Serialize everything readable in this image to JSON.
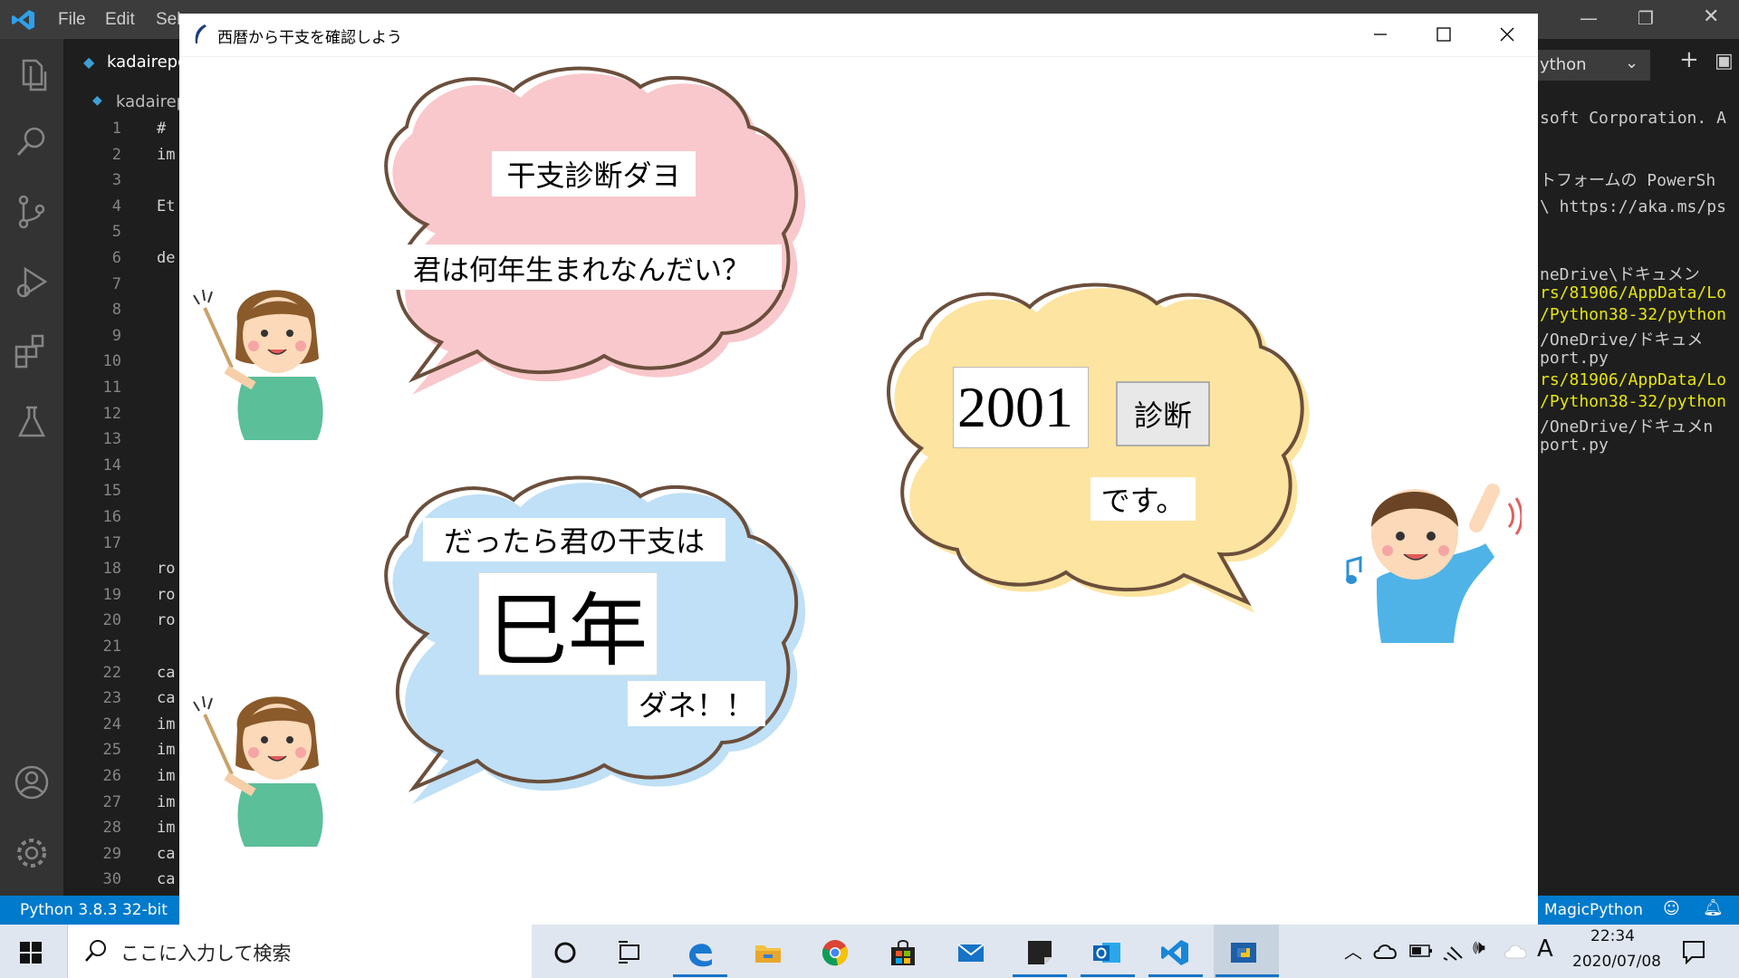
{
  "vscode": {
    "menu": [
      "File",
      "Edit",
      "Sel"
    ],
    "tab_label": "kadairepo",
    "breadcrumb_label": "kadairep",
    "line_numbers": [
      "1",
      "2",
      "3",
      "4",
      "5",
      "6",
      "7",
      "8",
      "9",
      "10",
      "11",
      "12",
      "13",
      "14",
      "15",
      "16",
      "17",
      "18",
      "19",
      "20",
      "21",
      "22",
      "23",
      "24",
      "25",
      "26",
      "27",
      "28",
      "29",
      "30"
    ],
    "code_lines": [
      "#",
      "im",
      "",
      "Et",
      "",
      "de",
      "",
      "",
      "",
      "",
      "",
      "",
      "",
      "",
      "",
      "",
      "",
      "ro",
      "ro",
      "ro",
      "",
      "ca",
      "ca",
      "im",
      "im",
      "im",
      "im",
      "im",
      "ca",
      "ca"
    ],
    "terminal_dropdown": "ython",
    "terminal_lines": [
      {
        "text": "soft Corporation. A",
        "color": "#cccccc"
      },
      {
        "text": "トフォームの PowerSh",
        "color": "#cccccc"
      },
      {
        "text": "\\ https://aka.ms/ps",
        "color": "#cccccc"
      },
      {
        "text": "neDrive\\ドキュメン",
        "color": "#cccccc"
      },
      {
        "text": "rs/81906/AppData/Lo",
        "color": "#e5e510"
      },
      {
        "text": "/Python38-32/python",
        "color": "#e5e510"
      },
      {
        "text": "/OneDrive/ドキュメ",
        "color": "#cccccc"
      },
      {
        "text": "port.py",
        "color": "#cccccc"
      },
      {
        "text": "rs/81906/AppData/Lo",
        "color": "#e5e510"
      },
      {
        "text": "/Python38-32/python",
        "color": "#e5e510"
      },
      {
        "text": "/OneDrive/ドキュメn",
        "color": "#cccccc"
      },
      {
        "text": "port.py",
        "color": "#cccccc"
      }
    ],
    "status_left": "Python 3.8.3 32-bit",
    "status_right": "MagicPython"
  },
  "tk": {
    "window_title": "西暦から干支を確認しよう",
    "bubble1_title": "干支診断ダヨ",
    "bubble1_question": "君は何年生まれなんだい？",
    "year_input_value": "2001",
    "diagnose_button": "診断",
    "desu_label": "です。",
    "result_prefix": "だったら君の干支は",
    "result_value": "巳年",
    "result_suffix": "ダネ！！"
  },
  "taskbar": {
    "search_placeholder": "ここに入力して検索",
    "time": "22:34",
    "date": "2020/07/08",
    "ime": "A"
  },
  "colors": {
    "bubble_pink": "#f9c8cc",
    "bubble_yellow": "#fde4a0",
    "bubble_blue": "#bfe0f6",
    "vscode_status": "#007acc",
    "taskbar": "#dfe6ef"
  }
}
